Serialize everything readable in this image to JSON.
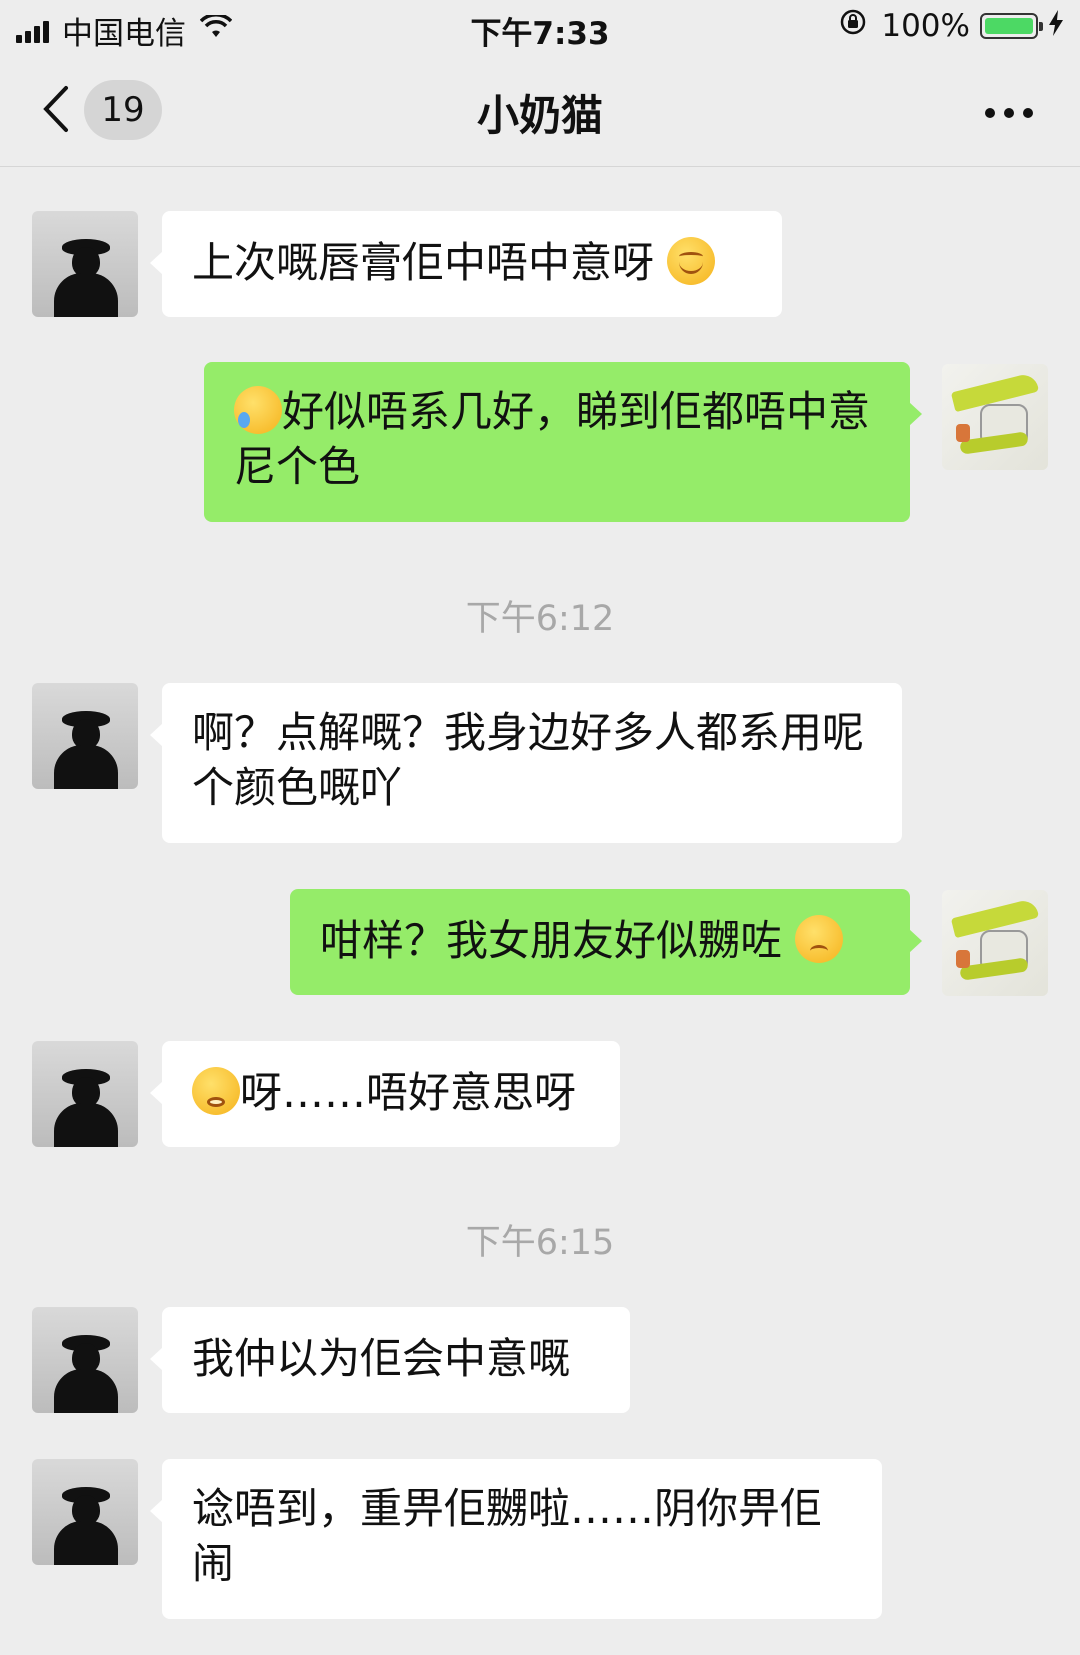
{
  "status_bar": {
    "carrier": "中国电信",
    "time": "下午7:33",
    "battery": "100%"
  },
  "nav": {
    "unread_count": "19",
    "title": "小奶猫"
  },
  "messages": [
    {
      "sender": "other",
      "text": "上次嘅唇膏佢中唔中意呀",
      "emoji": "smile"
    },
    {
      "sender": "me",
      "text": "好似唔系几好，睇到佢都唔中意尼个色",
      "emoji": "cry-laugh"
    },
    {
      "type": "time",
      "text": "下午6:12"
    },
    {
      "sender": "other",
      "text": "啊？点解嘅？我身边好多人都系用呢个颜色嘅吖"
    },
    {
      "sender": "me",
      "text": "咁样？我女朋友好似嬲咗",
      "emoji": "sad-sweat"
    },
    {
      "sender": "other",
      "text": "呀……唔好意思呀",
      "emoji": "worried"
    },
    {
      "type": "time",
      "text": "下午6:15"
    },
    {
      "sender": "other",
      "text": "我仲以为佢会中意嘅"
    },
    {
      "sender": "other",
      "text": "谂唔到，重畀佢嬲啦……阴你畀佢闹"
    }
  ],
  "colors": {
    "background": "#ededed",
    "bubble_other": "#ffffff",
    "bubble_me": "#95ec69",
    "timestamp": "#a8a8a8"
  },
  "icons": [
    "signal-icon",
    "wifi-icon",
    "rotation-lock-icon",
    "battery-icon",
    "charging-icon",
    "back-icon",
    "more-icon"
  ]
}
